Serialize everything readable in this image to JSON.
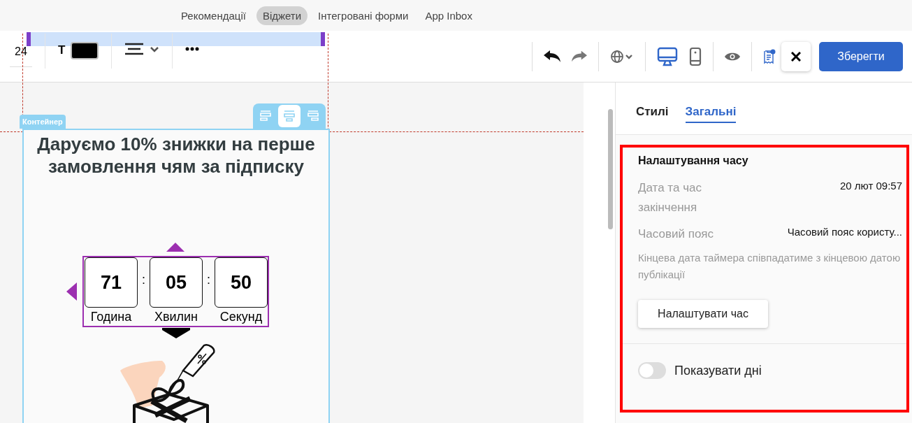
{
  "nav_tabs": [
    {
      "label": "Рекомендації",
      "selected": false
    },
    {
      "label": "Віджети",
      "selected": true
    },
    {
      "label": "Інтегровані форми",
      "selected": false
    },
    {
      "label": "App Inbox",
      "selected": false
    }
  ],
  "text_toolbar": {
    "font_size": "24",
    "bold_mark": "T"
  },
  "toolbar": {
    "devices": [
      {
        "kind": "desktop",
        "selected": true
      },
      {
        "kind": "mobile",
        "selected": false
      }
    ],
    "notification_dot": true,
    "save_button": "Зберегти"
  },
  "canvas": {
    "container_label": "Контейнер",
    "alignments": [
      {
        "kind": "left",
        "selected": false
      },
      {
        "kind": "center",
        "selected": true
      },
      {
        "kind": "right",
        "selected": false
      }
    ],
    "heading": "Даруємо 10% знижки на перше замовлення чям за підписку",
    "timer": {
      "separator": ":",
      "units": [
        {
          "value": "71",
          "label": "Година"
        },
        {
          "value": "05",
          "label": "Хвилин"
        },
        {
          "value": "50",
          "label": "Секунд"
        }
      ]
    }
  },
  "panel": {
    "tabs": [
      {
        "label": "Стилі",
        "selected": false
      },
      {
        "label": "Загальні",
        "selected": true
      }
    ],
    "highlighted": true,
    "section_title": "Налаштування часу",
    "fields": [
      {
        "label": "Дата та час закінчення",
        "value": "20 лют 09:57"
      },
      {
        "label": "Часовий пояс",
        "value": "Часовий пояс користу..."
      }
    ],
    "note": "Кінцева дата таймера співпадатиме з кінцевою датою публікації",
    "set_time_button": "Налаштувати час",
    "show_days": {
      "label": "Показувати дні",
      "on": false
    }
  }
}
